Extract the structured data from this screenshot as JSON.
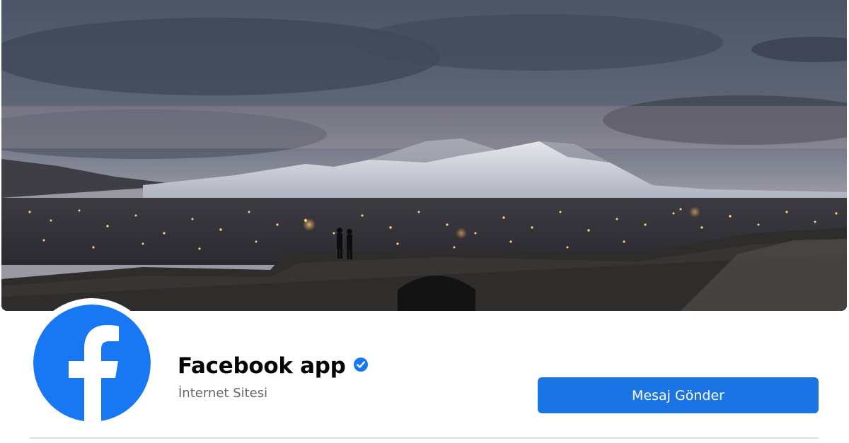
{
  "cover": {
    "description_icon": "cover-photo"
  },
  "profile": {
    "avatar_icon": "facebook-logo-icon",
    "brand_color": "#1877f2",
    "name": "Facebook app",
    "verified_icon": "verified-badge-icon",
    "category": "İnternet Sitesi"
  },
  "actions": {
    "message_button_label": "Mesaj Gönder",
    "button_color": "#1b74e4"
  }
}
